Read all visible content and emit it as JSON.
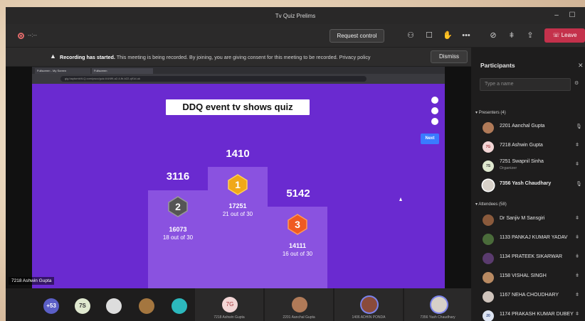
{
  "window": {
    "title": "Tv Quiz Prelims"
  },
  "toolbar": {
    "timer": "--:--",
    "request_control": "Request control",
    "leave": "Leave",
    "icons": [
      "people-icon",
      "chat-icon",
      "raise-hand-icon",
      "more-icon",
      "camera-off-icon",
      "mic-off-icon",
      "share-icon"
    ]
  },
  "notice": {
    "bold": "Recording has started.",
    "text": "This meeting is being recorded. By joining, you are giving consent for this meeting to be recorded. Privacy policy",
    "dismiss": "Dismiss"
  },
  "shared_screen": {
    "browser_tabs": [
      "Fullscreen - My Screen",
      "Fullscreen"
    ],
    "url": "gig.haytomb/it-Q.com/pscc/guiz-f/d/4f9-a2-4-fb-b22-q91d-uk",
    "quiz_title": "DDQ event tv shows quiz",
    "next": "Next",
    "podium": [
      {
        "rank": "2",
        "score": "3116",
        "points": "16073",
        "detail": "18 out of 30"
      },
      {
        "rank": "1",
        "score": "1410",
        "points": "17251",
        "detail": "21 out of 30"
      },
      {
        "rank": "3",
        "score": "5142",
        "points": "14111",
        "detail": "16 out of 30"
      }
    ],
    "presenter_tag": "7218 Ashwin Gupta"
  },
  "bottom_bar": {
    "overflow": "+53",
    "initials": "7S",
    "tiles": [
      {
        "initials": "7G",
        "name": "7218 Ashwin Gupta"
      },
      {
        "initials": "",
        "name": "2201 Aanchal Gupta"
      },
      {
        "initials": "",
        "name": "1406 ADHIN PONDA"
      },
      {
        "initials": "",
        "name": "7356 Yash Chaudhary"
      }
    ]
  },
  "participants": {
    "title": "Participants",
    "search_placeholder": "Type a name",
    "presenters_label": "Presenters (4)",
    "attendees_label": "Attendees (58)",
    "presenters": [
      {
        "name": "2201 Aanchal Gupta",
        "initials": "",
        "color": "#b07a58",
        "bold": false
      },
      {
        "name": "7218 Ashwin Gupta",
        "initials": "7G",
        "color": "#f3d6d6",
        "bold": false
      },
      {
        "name": "7251 Swapnil Sinha",
        "initials": "7S",
        "color": "#dfe8cf",
        "role": "Organizer",
        "bold": false
      },
      {
        "name": "7356 Yash Chaudhary",
        "initials": "",
        "color": "#d7d0c8",
        "bold": true
      }
    ],
    "attendees": [
      {
        "name": "Dr Sanjiv M Sansgiri",
        "initials": "",
        "color": "#8a5a3c"
      },
      {
        "name": "1133 PANKAJ KUMAR YADAV",
        "initials": "",
        "color": "#4a6b3a"
      },
      {
        "name": "1134 PRATEEK SIKARWAR",
        "initials": "",
        "color": "#5a3b6e"
      },
      {
        "name": "1158 VISHAL SINGH",
        "initials": "",
        "color": "#b98a62"
      },
      {
        "name": "1167 NEHA CHOUDHARY",
        "initials": "",
        "color": "#cfc4bc"
      },
      {
        "name": "1174 PRAKASH KUMAR DUBEY",
        "initials": "20",
        "color": "#dde4f2"
      }
    ]
  }
}
